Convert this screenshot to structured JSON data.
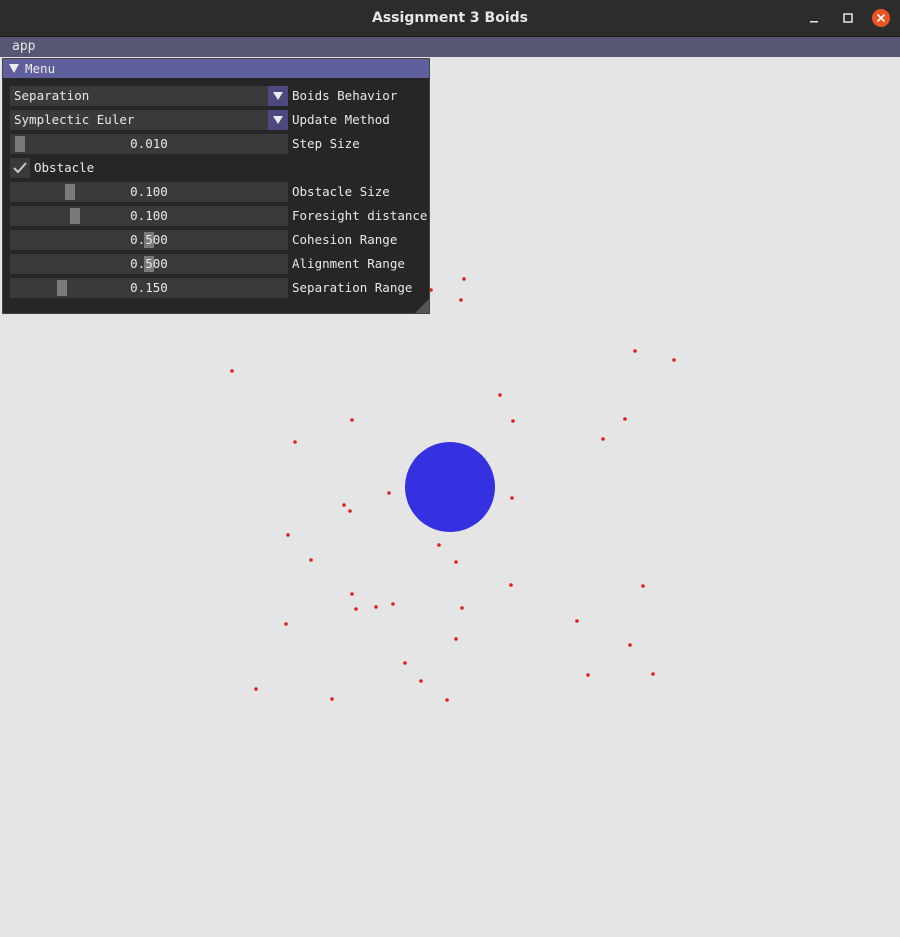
{
  "window": {
    "title": "Assignment 3 Boids"
  },
  "menubar": {
    "app_label": "app"
  },
  "panel": {
    "title": "Menu",
    "behavior": {
      "value": "Separation",
      "label": "Boids Behavior"
    },
    "update_method": {
      "value": "Symplectic Euler",
      "label": "Update Method"
    },
    "step_size": {
      "value": "0.010",
      "label": "Step Size",
      "fraction": 0.01
    },
    "obstacle": {
      "label": "Obstacle",
      "checked": true
    },
    "obstacle_size": {
      "value": "0.100",
      "label": "Obstacle Size",
      "fraction": 0.2
    },
    "foresight": {
      "value": "0.100",
      "label": "Foresight distance",
      "fraction": 0.22
    },
    "cohesion": {
      "value": "0.500",
      "label": "Cohesion Range",
      "fraction": 0.5
    },
    "alignment": {
      "value": "0.500",
      "label": "Alignment Range",
      "fraction": 0.5
    },
    "separation": {
      "value": "0.150",
      "label": "Separation Range",
      "fraction": 0.17
    }
  },
  "colors": {
    "obstacle": "#3530e0",
    "boid": "#e02020",
    "accent": "#5f5f9e"
  }
}
